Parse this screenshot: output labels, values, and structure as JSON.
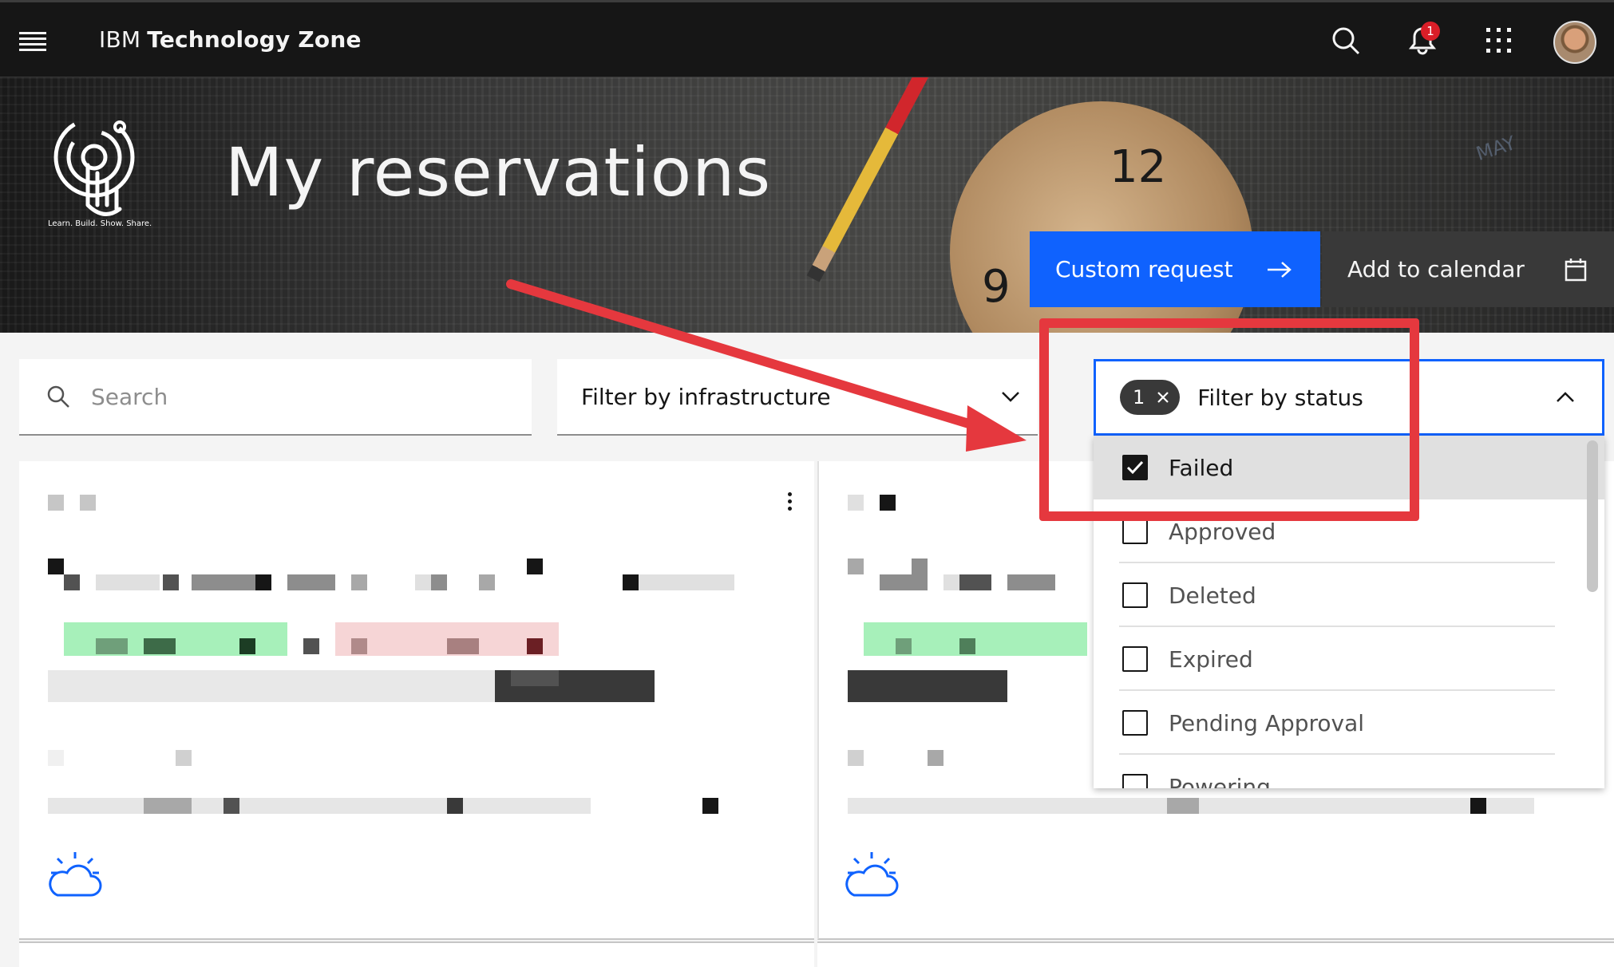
{
  "topnav": {
    "brand_prefix": "IBM",
    "brand_name": "Technology Zone",
    "notification_count": "1"
  },
  "hero": {
    "logo_tagline": "Learn. Build. Show. Share.",
    "title": "My reservations",
    "clock_numbers": [
      "12",
      "9"
    ],
    "calendar_text": "MAY",
    "primary_button": "Custom request",
    "secondary_button": "Add to calendar"
  },
  "filters": {
    "search_placeholder": "Search",
    "infrastructure_label": "Filter by infrastructure",
    "status_label": "Filter by status",
    "status_selected_count": "1"
  },
  "status_menu": {
    "items": [
      {
        "label": "Failed",
        "checked": true
      },
      {
        "label": "Approved",
        "checked": false
      },
      {
        "label": "Deleted",
        "checked": false
      },
      {
        "label": "Expired",
        "checked": false
      },
      {
        "label": "Pending Approval",
        "checked": false
      },
      {
        "label": "Powering",
        "checked": false
      }
    ]
  },
  "colors": {
    "primary": "#0f62fe",
    "nav_bg": "#161616",
    "annotation": "#e5383e",
    "tag_bg": "#393939"
  },
  "icons": {
    "menu": "hamburger-icon",
    "search": "search-icon",
    "notification": "bell-icon",
    "apps": "app-switcher-icon",
    "primary_button": "arrow-right-icon",
    "secondary_button": "calendar-icon",
    "chevron_down": "chevron-down-icon",
    "chevron_up": "chevron-up-icon",
    "card": "ibm-cloud-icon"
  }
}
